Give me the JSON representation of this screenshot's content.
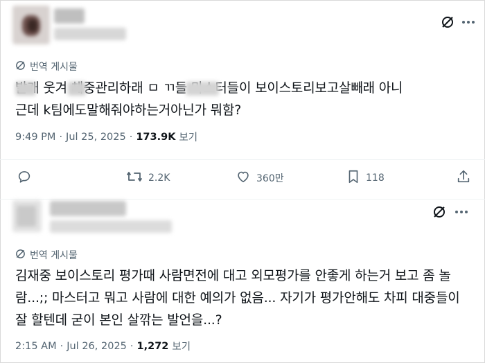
{
  "tweet1": {
    "translated_label": "번역 게시물",
    "text_line1": "발개  웃겨 체중관리하래 ㅁ   ㄲ들 마스터들이 보이스토리보고살빼래 아니",
    "text_line2": "근데 k팀에도말해줘야하는거아닌가 뭐함?",
    "time": "9:49 PM",
    "date": "Jul 25, 2025",
    "views": "173.9K",
    "views_label": "보기",
    "actions": {
      "reply": "",
      "retweets": "2.2K",
      "likes": "360만",
      "bookmarks": "118"
    }
  },
  "tweet2": {
    "translated_label": "번역 게시물",
    "text_line1": "김재중 보이스토리 평가때 사람면전에 대고 외모평가를 안좋게 하는거 보고 좀 놀",
    "text_line2": "람...;; 마스터고 뭐고 사람에 대한 예의가 없음... 자기가 평가안해도 차피 대중들이",
    "text_line3": "잘 할텐데 굳이 본인 살깎는 발언을...?",
    "time": "2:15 AM",
    "date": "Jul 26, 2025",
    "views": "1,272",
    "views_label": "보기"
  },
  "separator": "·",
  "icons": {
    "grok": "grok-icon",
    "more": "more-icon",
    "translate": "translate-icon",
    "reply": "reply-icon",
    "retweet": "retweet-icon",
    "like": "heart-icon",
    "bookmark": "bookmark-icon",
    "share": "share-icon"
  },
  "colors": {
    "text": "#0f1419",
    "secondary": "#536471",
    "background": "#ffffff"
  }
}
